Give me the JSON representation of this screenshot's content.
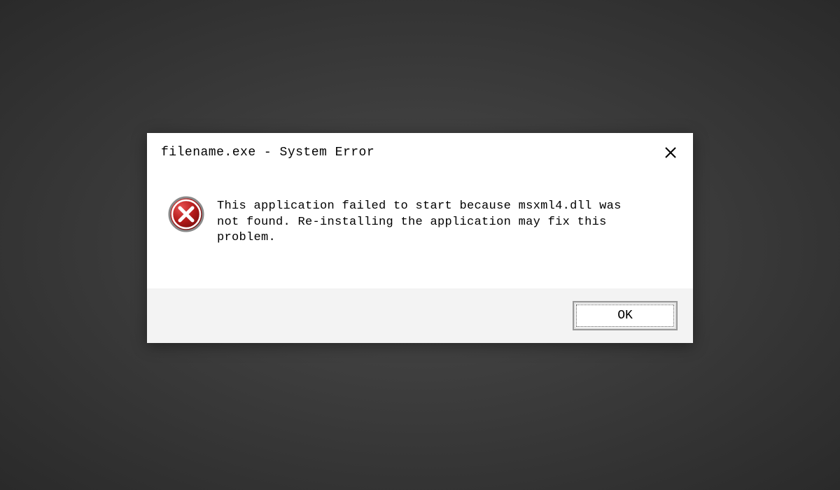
{
  "dialog": {
    "title": "filename.exe - System Error",
    "message": "This application failed to start because msxml4.dll was\nnot found. Re-installing the application may fix this problem.",
    "ok_label": "OK"
  }
}
